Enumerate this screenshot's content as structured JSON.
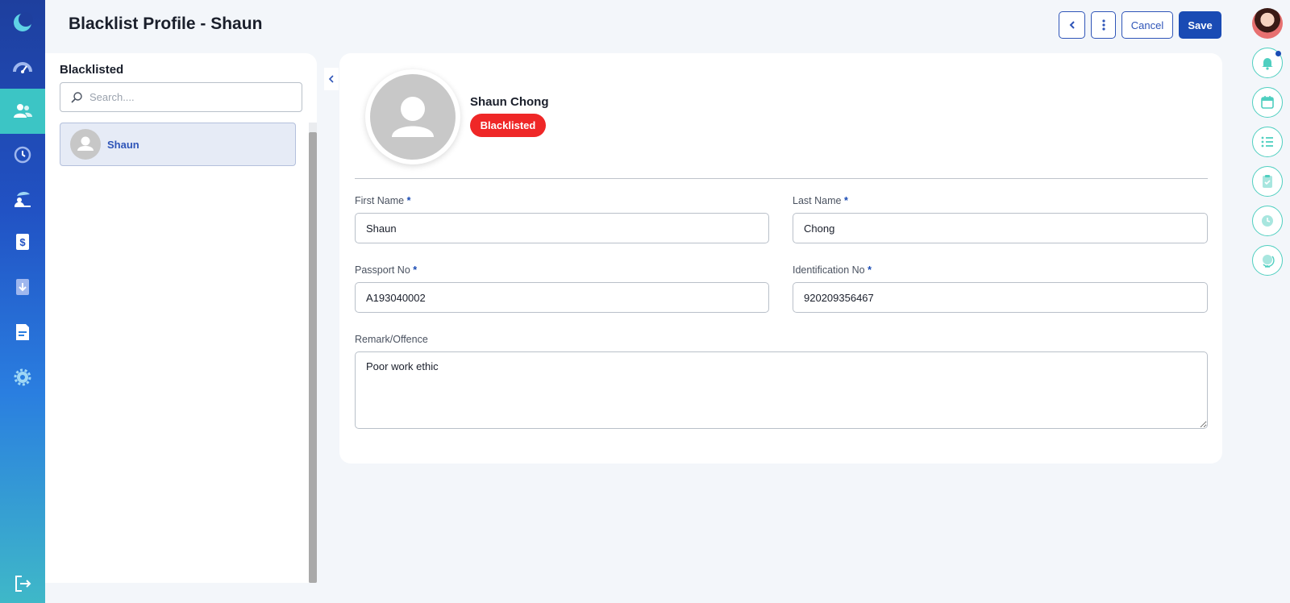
{
  "header": {
    "title": "Blacklist Profile - Shaun",
    "back_icon": "chevron-left-icon",
    "more_icon": "more-vertical-icon",
    "cancel_label": "Cancel",
    "save_label": "Save"
  },
  "sidebar": {
    "items": [
      {
        "name": "app-logo",
        "icon": "moon-logo-icon"
      },
      {
        "name": "dashboard",
        "icon": "speedometer-icon"
      },
      {
        "name": "people",
        "icon": "users-icon",
        "active": true
      },
      {
        "name": "history",
        "icon": "history-icon"
      },
      {
        "name": "leave",
        "icon": "beach-icon"
      },
      {
        "name": "payroll",
        "icon": "dollar-doc-icon"
      },
      {
        "name": "claims",
        "icon": "add-doc-icon"
      },
      {
        "name": "reports",
        "icon": "document-icon"
      },
      {
        "name": "settings",
        "icon": "gear-icon"
      },
      {
        "name": "logout",
        "icon": "logout-icon"
      }
    ]
  },
  "right_rail": {
    "items": [
      "bell-icon",
      "calendar-icon",
      "list-icon",
      "clipboard-icon",
      "clock-icon",
      "globe-icon"
    ]
  },
  "list_panel": {
    "title": "Blacklisted",
    "search_placeholder": "Search....",
    "items": [
      {
        "name": "Shaun"
      }
    ]
  },
  "profile": {
    "full_name": "Shaun Chong",
    "status": "Blacklisted",
    "status_color": "#ef2727"
  },
  "form": {
    "first_name_label": "First Name",
    "first_name": "Shaun",
    "last_name_label": "Last Name",
    "last_name": "Chong",
    "passport_label": "Passport No",
    "passport": "A193040002",
    "identification_label": "Identification No",
    "identification": "920209356467",
    "remark_label": "Remark/Offence",
    "remark": "Poor work ethic",
    "required_mark": "*"
  },
  "colors": {
    "primary": "#1a4bb4",
    "accent_teal": "#3cc5c5",
    "danger": "#ef2727"
  }
}
